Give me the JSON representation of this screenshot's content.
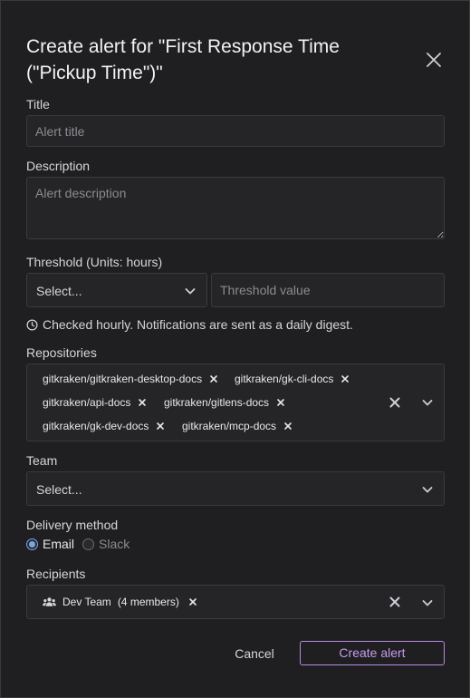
{
  "dialog": {
    "title": "Create alert for \"First Response Time (\"Pickup Time\")\""
  },
  "fields": {
    "title_label": "Title",
    "title_placeholder": "Alert title",
    "description_label": "Description",
    "description_placeholder": "Alert description",
    "threshold_label": "Threshold (Units: hours)",
    "threshold_select_value": "Select...",
    "threshold_value_placeholder": "Threshold value",
    "info_text": "Checked hourly. Notifications are sent as a daily digest.",
    "repositories_label": "Repositories",
    "repositories": [
      "gitkraken/gitkraken-desktop-docs",
      "gitkraken/gk-cli-docs",
      "gitkraken/api-docs",
      "gitkraken/gitlens-docs",
      "gitkraken/gk-dev-docs",
      "gitkraken/mcp-docs"
    ],
    "team_label": "Team",
    "team_select_value": "Select...",
    "delivery_label": "Delivery method",
    "delivery_options": [
      "Email",
      "Slack"
    ],
    "delivery_selected": "Email",
    "recipients_label": "Recipients",
    "recipient_chip": {
      "name": "Dev Team",
      "count": "(4 members)",
      "icon": "users-icon"
    }
  },
  "actions": {
    "cancel_label": "Cancel",
    "create_label": "Create alert"
  },
  "colors": {
    "background": "#1f1f21",
    "primary_accent": "#c79bf0",
    "radio_accent": "#7ea3e6"
  }
}
